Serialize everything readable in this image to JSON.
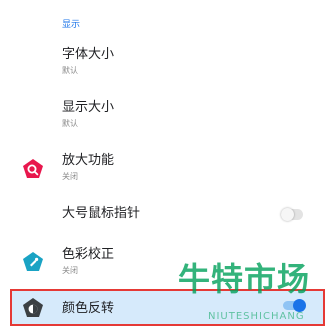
{
  "section": {
    "header": "显示"
  },
  "items": [
    {
      "title": "字体大小",
      "subtitle": "默认"
    },
    {
      "title": "显示大小",
      "subtitle": "默认"
    },
    {
      "title": "放大功能",
      "subtitle": "关闭",
      "icon": "magnifier-icon"
    },
    {
      "title": "大号鼠标指针",
      "toggle": false
    },
    {
      "title": "色彩校正",
      "subtitle": "关闭",
      "icon": "color-correction-icon"
    },
    {
      "title": "颜色反转",
      "toggle": true,
      "icon": "color-inversion-icon",
      "highlighted": true
    }
  ],
  "watermark": {
    "cn": "牛特市场",
    "en": "NIUTESHICHANG"
  },
  "colors": {
    "accent": "#1a73e8",
    "magnifier_icon": "#e8174d",
    "color_correction_icon": "#1aa3c4",
    "color_inversion_icon": "#3c4043",
    "highlight_bg": "#d6eafb",
    "highlight_border": "#e53935"
  }
}
